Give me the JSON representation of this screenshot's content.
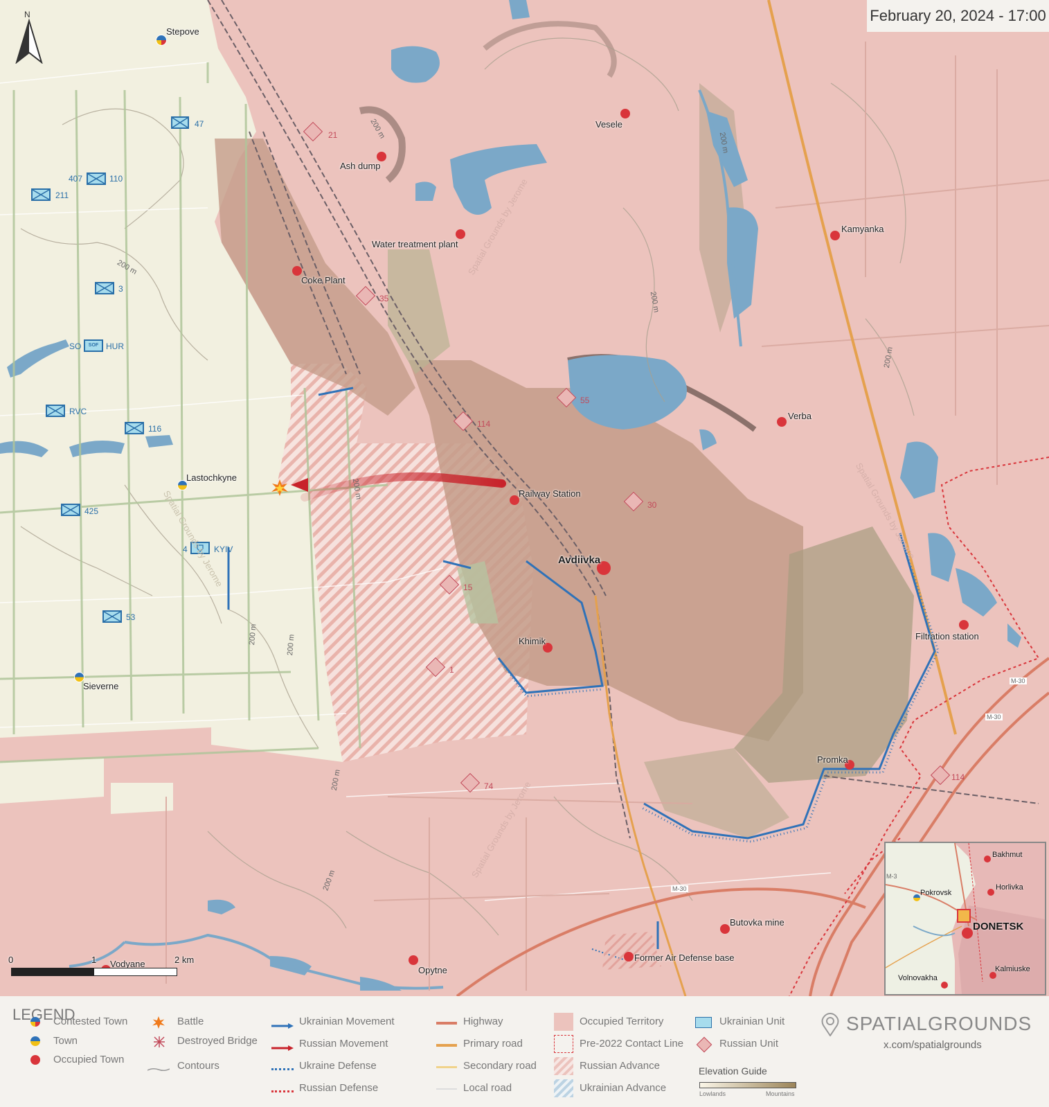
{
  "date_label": "February 20, 2024 - 17:00",
  "north_label": "N",
  "places": {
    "stepove": "Stepove",
    "vesele": "Vesele",
    "ash_dump": "Ash dump",
    "water_treatment": "Water treatment plant",
    "kamyanka": "Kamyanka",
    "coke_plant": "Coke Plant",
    "verba": "Verba",
    "lastochkyne": "Lastochkyne",
    "railway_station": "Railway Station",
    "avdiivka": "Avdiivka",
    "khimik": "Khimik",
    "filtration": "Filtration station",
    "sieverne": "Sieverne",
    "promka": "Promka",
    "butovka": "Butovka mine",
    "former_air": "Former Air Defense base",
    "vodyane": "Vodyane",
    "opytne": "Opytne"
  },
  "ua_units": {
    "u47": "47",
    "u407": "407",
    "u110": "110",
    "u211": "211",
    "u3": "3",
    "so": "SO",
    "sof": "SOF",
    "hur": "HUR",
    "rvc": "RVC",
    "u116": "116",
    "u425": "425",
    "u4": "4",
    "kyiv": "KYIV",
    "u53": "53"
  },
  "ru_units": {
    "r21": "21",
    "r35": "35",
    "r55": "55",
    "r114a": "114",
    "r30": "30",
    "r15": "15",
    "r1": "1",
    "r74": "74",
    "r114b": "114"
  },
  "contour_labels": {
    "c1": "200 m",
    "c2": "200 m",
    "c3": "200 m",
    "c4": "200 m",
    "c5": "200 m",
    "c6": "200 m",
    "c7": "200 m",
    "c8": "200 m",
    "c9": "200 m",
    "c10": "200 m"
  },
  "road_labels": {
    "m30a": "M-30",
    "m30b": "M-30",
    "m30c": "M-30",
    "m3": "M-3"
  },
  "watermark": "Spatial Grounds by Jerome",
  "scale": {
    "zero": "0",
    "one": "1",
    "two": "2 km"
  },
  "minimap": {
    "bakhmut": "Bakhmut",
    "horlivka": "Horlivka",
    "pokrovsk": "Pokrovsk",
    "donetsk": "DONETSK",
    "kalmiuske": "Kalmiuske",
    "volnovakha": "Volnovakha"
  },
  "legend": {
    "title": "LEGEND",
    "contested_town": "Contested Town",
    "town": "Town",
    "occupied_town": "Occupied Town",
    "battle": "Battle",
    "destroyed_bridge": "Destroyed Bridge",
    "contours": "Contours",
    "ukrainian_movement": "Ukrainian Movement",
    "russian_movement": "Russian Movement",
    "ukraine_defense": "Ukraine Defense",
    "russian_defense": "Russian Defense",
    "highway": "Highway",
    "primary_road": "Primary road",
    "secondary_road": "Secondary road",
    "local_road": "Local road",
    "occupied_territory": "Occupied Territory",
    "pre2022_line": "Pre-2022 Contact Line",
    "russian_advance": "Russian Advance",
    "ukrainian_advance": "Ukrainian Advance",
    "ukrainian_unit": "Ukrainian Unit",
    "russian_unit": "Russian Unit",
    "elevation_guide": "Elevation Guide",
    "lowlands": "Lowlands",
    "mountains": "Mountains"
  },
  "brand": {
    "name": "SPATIALGROUNDS",
    "url": "x.com/spatialgrounds"
  },
  "colors": {
    "occupied": "#ecc3bd",
    "ukraine_land": "#f2f0e0",
    "water": "#7ba8c8",
    "russian_red": "#d9353b",
    "ukraine_blue": "#2f72b8",
    "highway": "#d97d66",
    "primary_road": "#e5a14e"
  }
}
